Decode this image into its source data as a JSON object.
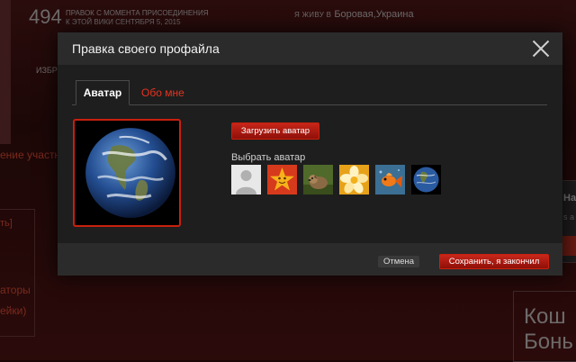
{
  "background": {
    "edit_count": "494",
    "edit_count_label_1": "ПРАВОК С МОМЕНТА ПРИСОЕДИНЕНИЯ",
    "edit_count_label_2": "К ЭТОЙ ВИКИ СЕНТЯБРЯ 5, 2015",
    "live_label": "Я ЖИВУ В",
    "live_value": "Боровая,Украина",
    "izbr": "ИЗБР",
    "red_link": "ение участни",
    "t1": "ть]",
    "t2": "аторы",
    "t3": "ейки)",
    "side_title": "Нат",
    "side_text": "s a",
    "big_t1": "Кош",
    "big_t2": "Бонь"
  },
  "modal": {
    "title": "Правка своего профайла",
    "tabs": [
      {
        "label": "Аватар",
        "active": true
      },
      {
        "label": "Обо мне",
        "active": false
      }
    ],
    "upload_button": "Загрузить аватар",
    "choose_label": "Выбрать аватар",
    "thumbnails": [
      {
        "name": "default-avatar"
      },
      {
        "name": "star-avatar"
      },
      {
        "name": "dog-avatar"
      },
      {
        "name": "flower-avatar"
      },
      {
        "name": "fish-avatar"
      },
      {
        "name": "earth-avatar"
      }
    ],
    "cancel_button": "Отмена",
    "save_button": "Сохранить, я закончил"
  },
  "colors": {
    "accent": "#c8200e",
    "modal_bg": "#1e1e1e",
    "header_bg": "#2b2b2b"
  }
}
